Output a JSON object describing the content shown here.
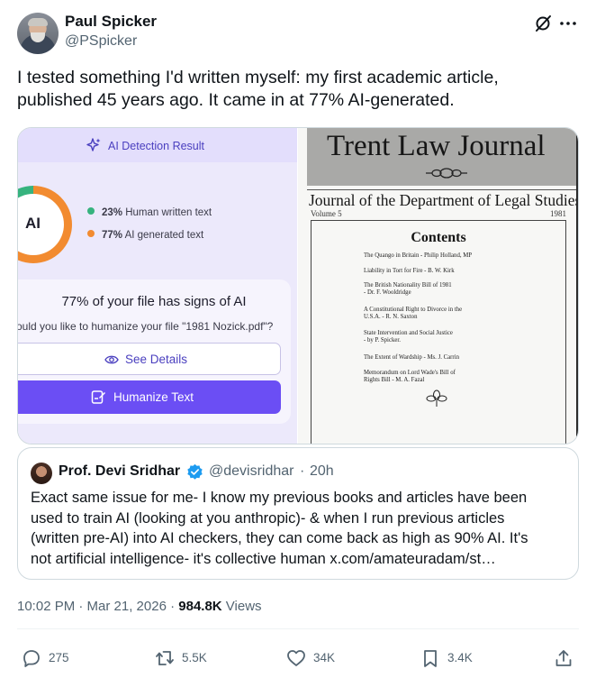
{
  "author": {
    "display_name": "Paul Spicker",
    "handle": "@PSpicker"
  },
  "tweet": {
    "lines": [
      "I tested something I'd written myself: my first academic article,",
      "published 45 years ago. It came in at 77% AI-generated."
    ]
  },
  "media": {
    "ai_detector": {
      "header": "AI Detection Result",
      "ring_label": "AI",
      "ai_share_percent": 77,
      "human": {
        "percent": "23%",
        "label": "Human written text",
        "color": "#36b37e"
      },
      "generated": {
        "percent": "77%",
        "label": "AI generated text",
        "color": "#f28b30"
      },
      "result_title": "77% of your file has signs of AI",
      "question": "ould you like to humanize your file \"1981 Nozick.pdf\"?",
      "see_details": "See Details",
      "humanize": "Humanize Text",
      "accent_color": "#6b4ef4"
    },
    "journal": {
      "title": "Trent Law Journal",
      "subtitle": "Journal of the Department of Legal Studies",
      "volume": "Volume 5",
      "year": "1981",
      "contents_heading": "Contents",
      "items": [
        [
          "The Quango in Britain - Philip Holland, MP"
        ],
        [
          "Liability in Tort for Fire - B. W. Kirk"
        ],
        [
          "The British Nationality Bill of 1981",
          "- Dr. F. Wooldridge"
        ],
        [
          "A Constitutional Right to Divorce in the",
          "U.S.A. - R. N. Saxton"
        ],
        [
          "State Intervention and Social Justice",
          "- by P. Spicker."
        ],
        [
          "The Extent of Wardship - Ms. J. Carrin"
        ],
        [
          "Memorandum on Lord Wade's Bill of",
          "Rights Bill - M. A. Fazal"
        ]
      ]
    }
  },
  "quote": {
    "name": "Prof. Devi Sridhar",
    "handle": "@devisridhar",
    "separator": "·",
    "time": "20h",
    "lines": [
      "Exact same issue for me- I know my previous books and articles have been",
      "used to train AI (looking at you anthropic)- & when I run previous articles",
      "(written pre-AI) into AI checkers, they can come back as high as 90% AI. It's",
      "not artificial intelligence- it's collective human x.com/amateuradam/st…"
    ]
  },
  "meta": {
    "timestamp": "10:02 PM · Mar 21, 2026 · ",
    "views_count": "984.8K",
    "views_label": " Views"
  },
  "actions": {
    "replies": "275",
    "reposts": "5.5K",
    "likes": "34K",
    "bookmarks": "3.4K"
  },
  "colors": {
    "text_primary": "#0f1419",
    "text_secondary": "#536471",
    "verified": "#1d9bf0",
    "border": "#cfd9de"
  }
}
